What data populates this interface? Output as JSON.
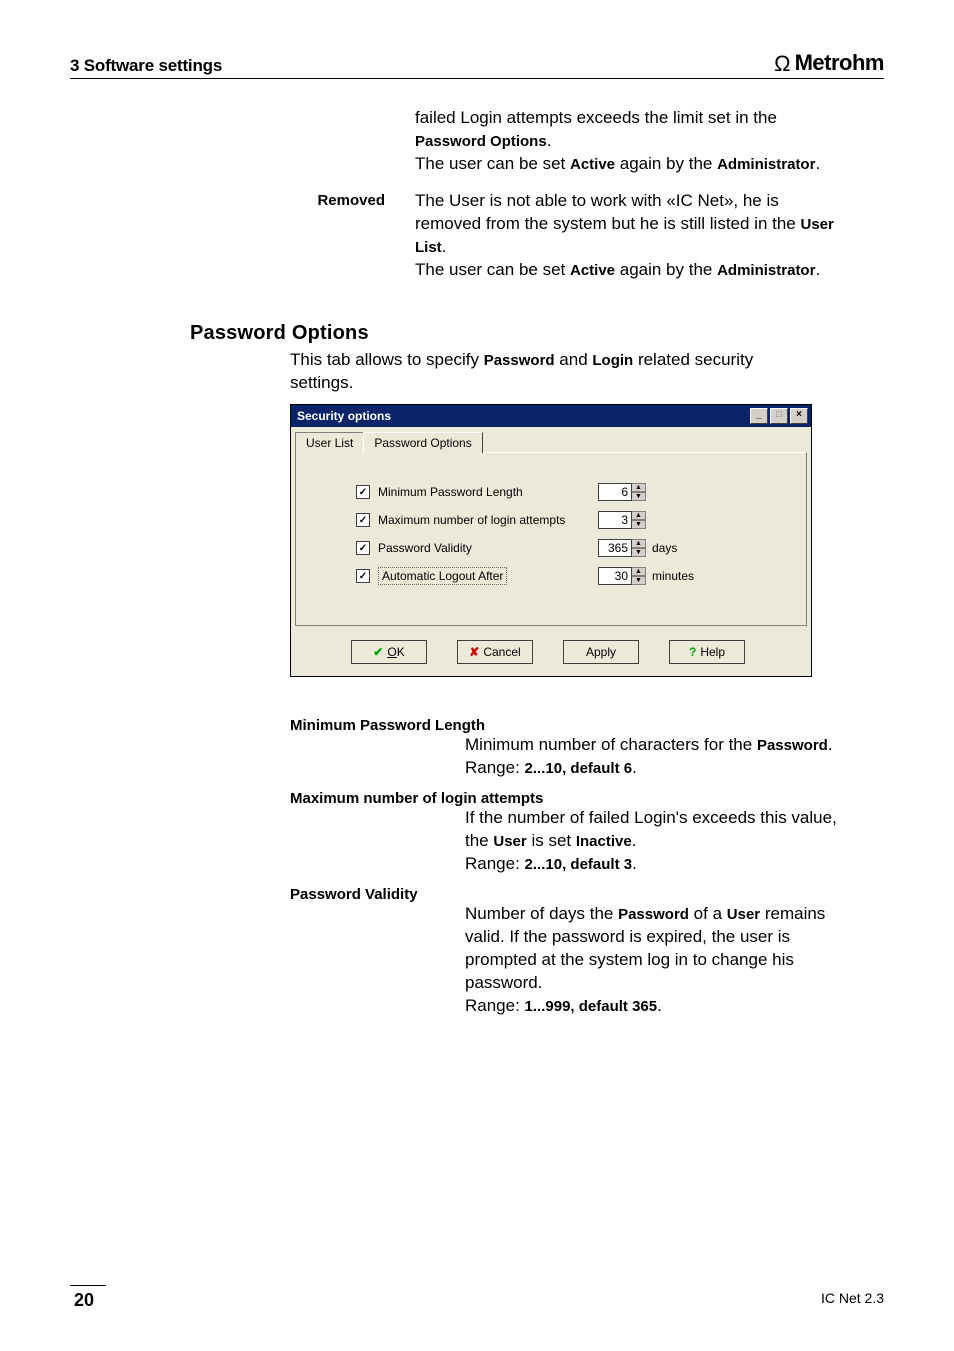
{
  "header": {
    "section_label": "3  Software settings",
    "brand": "Metrohm"
  },
  "top_blocks": [
    {
      "term": "",
      "body_html": "failed Login attempts exceeds the limit set in the <b>Password Options</b>.\nThe user can be set <b>Active</b> again by the <b>Administrator</b>."
    },
    {
      "term": "Removed",
      "body_html": "The User is not able to work with «IC Net», he is removed from the system but he is still listed in the <b>User List</b>.\nThe user can be set <b>Active</b> again by the <b>Administrator</b>."
    }
  ],
  "section": {
    "heading": "Password Options",
    "intro_html": "This tab allows to specify <b>Password</b> and <b>Login</b> related security settings."
  },
  "dialog": {
    "title": "Security options",
    "tabs": [
      {
        "label": "User List",
        "active": false
      },
      {
        "label": "Password Options",
        "active": true
      }
    ],
    "options": [
      {
        "checked": true,
        "label": "Minimum Password Length",
        "value": "6",
        "unit": ""
      },
      {
        "checked": true,
        "label": "Maximum number of login attempts",
        "value": "3",
        "unit": ""
      },
      {
        "checked": true,
        "label": "Password Validity",
        "value": "365",
        "unit": "days"
      },
      {
        "checked": true,
        "label": "Automatic Logout After",
        "value": "30",
        "unit": "minutes",
        "dashed": true
      }
    ],
    "buttons": {
      "ok": "OK",
      "cancel": "Cancel",
      "apply": "Apply",
      "help": "Help"
    }
  },
  "defs": [
    {
      "term": "Minimum Password Length",
      "body_html": "Minimum number of characters for the <b>Password</b>.\nRange: <b>2...10, default 6</b>."
    },
    {
      "term": "Maximum number of login attempts",
      "body_html": "If the number of failed Login's exceeds this value, the <b>User</b> is set <b>Inactive</b>.\nRange: <b>2...10, default 3</b>."
    },
    {
      "term": "Password Validity",
      "body_html": "Number of days the <b>Password</b> of a <b>User</b> remains valid. If the password is expired, the user is prompted at the system log in to change his password.\nRange: <b>1...999, default 365</b>."
    }
  ],
  "footer": {
    "page": "20",
    "product": "IC Net 2.3"
  }
}
